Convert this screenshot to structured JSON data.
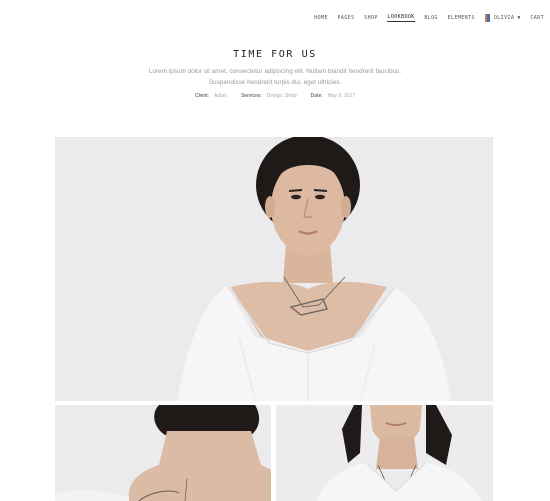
{
  "nav": {
    "items": [
      "HOME",
      "PAGES",
      "SHOP",
      "LOOKBOOK",
      "BLOG",
      "ELEMENTS"
    ],
    "active": "LOOKBOOK",
    "language": "OLIVIA",
    "cart": "CART"
  },
  "header": {
    "title": "TIME FOR US",
    "description": "Lorem ipsum dolor sit amet, consectetur adipiscing elit. Nullam blandit hendrerit faucibus. Suspendisse hendrerit turpis dui, eget ultricies."
  },
  "meta": {
    "client_label": "Client:",
    "client_value": "Adam",
    "services_label": "Services:",
    "services_value": "Design, Shop",
    "date_label": "Date:",
    "date_value": "May 9, 2017"
  },
  "colors": {
    "photo_background": "#ebebee",
    "shirt": "#f6f6f6",
    "hair": "#1f1a17",
    "skin": "#d9b59c"
  },
  "icons": {
    "flag": "flag-icon",
    "language_caret": "caret-down-icon"
  }
}
